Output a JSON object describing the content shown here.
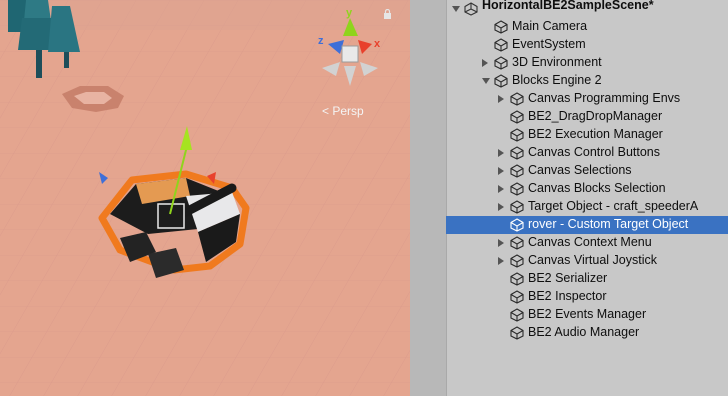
{
  "scene": {
    "persp_label": "Persp",
    "gizmo_axis_y": "y",
    "gizmo_axis_x": "x",
    "gizmo_axis_z": "z"
  },
  "hierarchy": {
    "scene_name": "HorizontalBE2SampleScene*",
    "items": [
      {
        "label": "Main Camera",
        "depth": 1,
        "expand": "none",
        "selected": false
      },
      {
        "label": "EventSystem",
        "depth": 1,
        "expand": "none",
        "selected": false
      },
      {
        "label": "3D Environment",
        "depth": 1,
        "expand": "collapsed",
        "selected": false
      },
      {
        "label": "Blocks Engine 2",
        "depth": 1,
        "expand": "expanded",
        "selected": false
      },
      {
        "label": "Canvas Programming Envs",
        "depth": 2,
        "expand": "collapsed",
        "selected": false
      },
      {
        "label": "BE2_DragDropManager",
        "depth": 2,
        "expand": "none",
        "selected": false
      },
      {
        "label": "BE2 Execution Manager",
        "depth": 2,
        "expand": "none",
        "selected": false
      },
      {
        "label": "Canvas Control Buttons",
        "depth": 2,
        "expand": "collapsed",
        "selected": false
      },
      {
        "label": "Canvas Selections",
        "depth": 2,
        "expand": "collapsed",
        "selected": false
      },
      {
        "label": "Canvas Blocks Selection",
        "depth": 2,
        "expand": "collapsed",
        "selected": false
      },
      {
        "label": "Target Object - craft_speederA",
        "depth": 2,
        "expand": "collapsed",
        "selected": false
      },
      {
        "label": "rover - Custom Target Object",
        "depth": 2,
        "expand": "none",
        "selected": true
      },
      {
        "label": "Canvas Context Menu",
        "depth": 2,
        "expand": "collapsed",
        "selected": false
      },
      {
        "label": "Canvas Virtual Joystick",
        "depth": 2,
        "expand": "collapsed",
        "selected": false
      },
      {
        "label": "BE2 Serializer",
        "depth": 2,
        "expand": "none",
        "selected": false
      },
      {
        "label": "BE2 Inspector",
        "depth": 2,
        "expand": "none",
        "selected": false
      },
      {
        "label": "BE2 Events Manager",
        "depth": 2,
        "expand": "none",
        "selected": false
      },
      {
        "label": "BE2 Audio Manager",
        "depth": 2,
        "expand": "none",
        "selected": false
      }
    ]
  },
  "colors": {
    "ground": "#e4a58f",
    "grid_line": "#d8978a",
    "selection": "#3a72c2",
    "outline_orange": "#f07a1e",
    "gizmo_x": "#e8412c",
    "gizmo_y": "#8fd41c",
    "gizmo_z": "#3e6fd8"
  }
}
